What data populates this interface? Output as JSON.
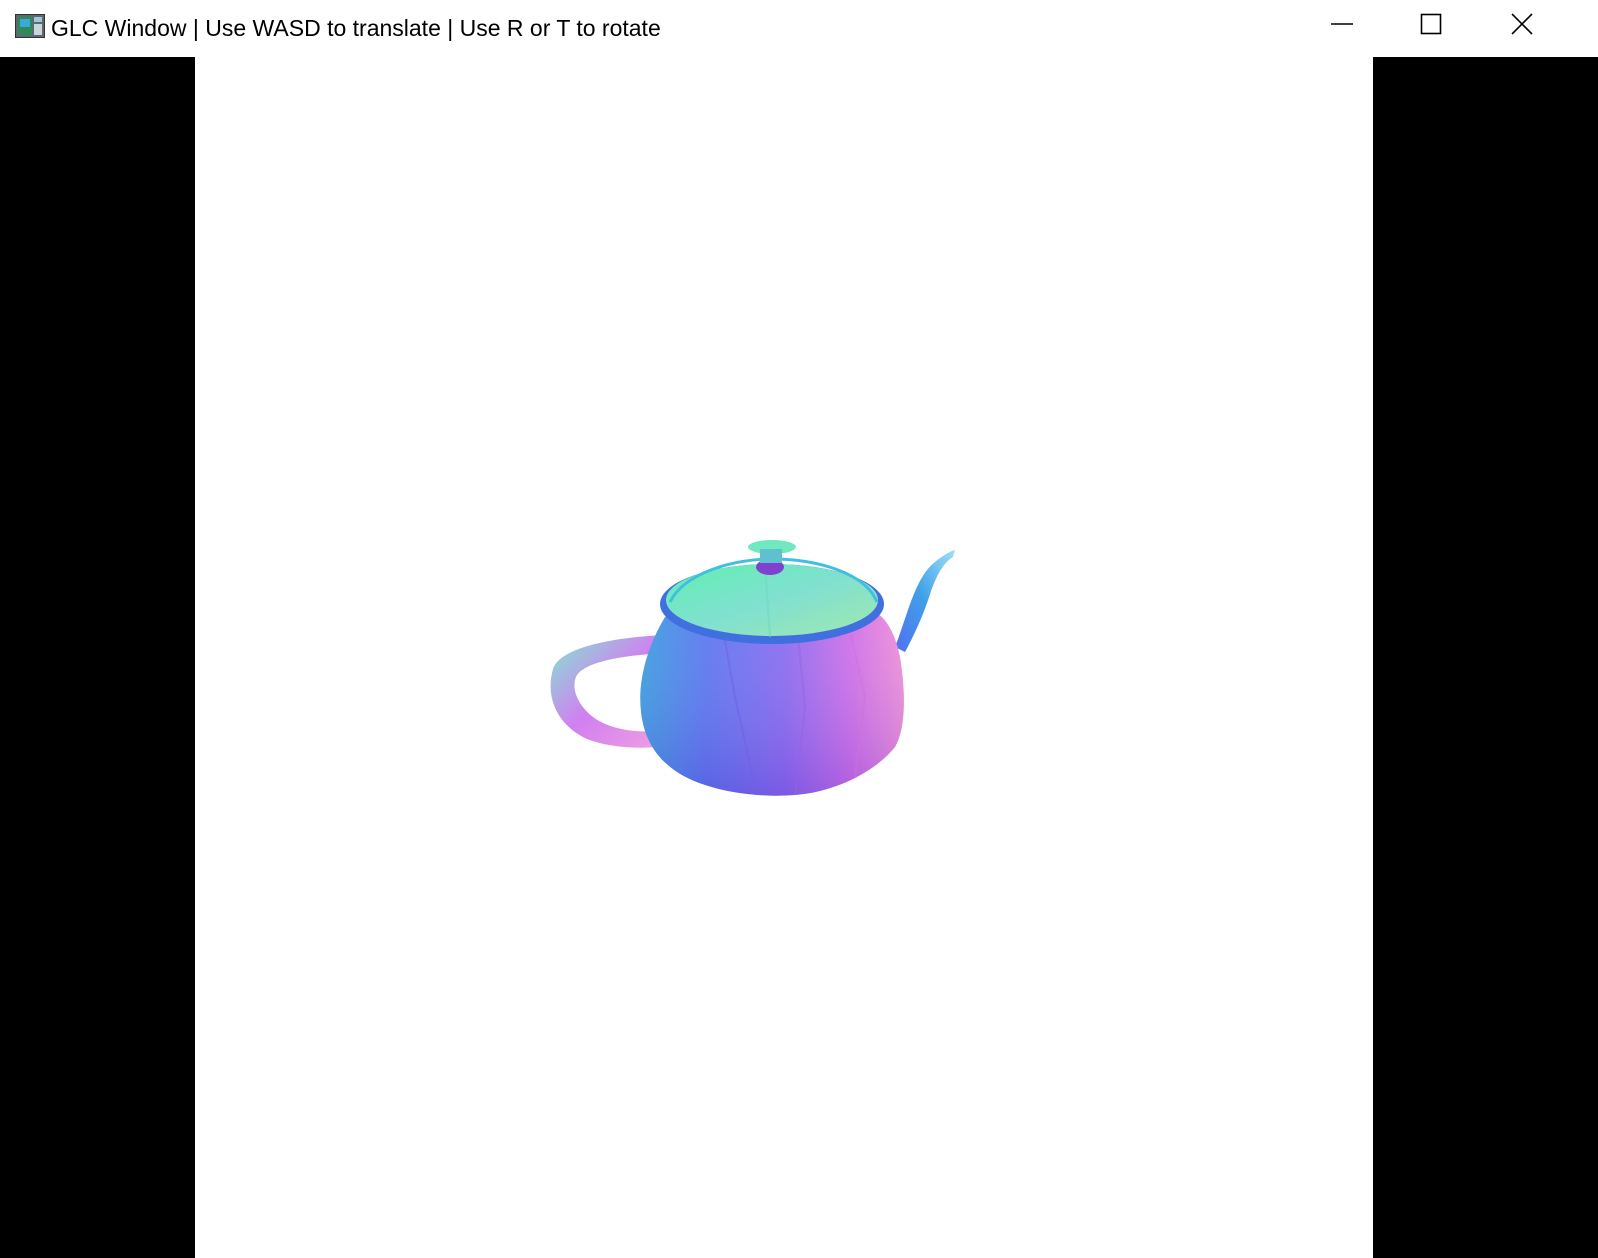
{
  "window": {
    "title": "GLC Window | Use WASD to translate | Use R or T to rotate",
    "icon": "app-window-icon"
  },
  "controls": {
    "minimize_icon": "minimize-icon",
    "maximize_icon": "maximize-icon",
    "close_icon": "close-icon"
  },
  "scene": {
    "object": "teapot",
    "background_color": "#ffffff",
    "letterbox_color": "#000000"
  }
}
